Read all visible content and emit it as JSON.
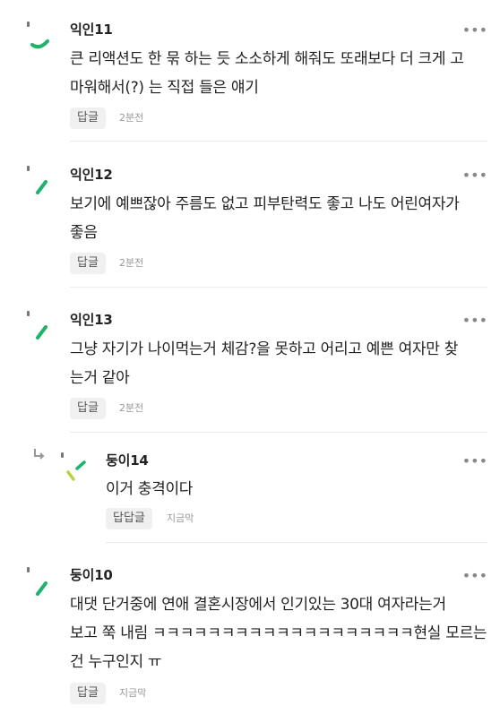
{
  "more_icon": "more-horizontal-icon",
  "comments": [
    {
      "author": "익인11",
      "lines": [
        "큰 리액션도 한 묶 하는 듯 소소하게 해줘도 또래보다 더 크게 고",
        "마워해서(?) 는 직접 들은 얘기"
      ],
      "reply_label": "답글",
      "time": "2분전"
    },
    {
      "author": "익인12",
      "lines": [
        "보기에 예쁘잖아 주름도 없고 피부탄력도 좋고 나도 어린여자가",
        "좋음"
      ],
      "reply_label": "답글",
      "time": "2분전"
    },
    {
      "author": "익인13",
      "lines": [
        "그냥 자기가 나이먹는거 체감?을 못하고 어리고 예쁜 여자만 찾",
        "는거 같아"
      ],
      "reply_label": "답글",
      "time": "2분전"
    },
    {
      "author": "둥이14",
      "lines": [
        "이거 충격이다"
      ],
      "reply_label": "답답글",
      "time": "지금막",
      "is_reply": true
    },
    {
      "author": "둥이10",
      "lines": [
        "대댓 단거중에 연애 결혼시장에서 인기있는 30대 여자라는거",
        "보고 쭉 내림 ㅋㅋㅋㅋㅋㅋㅋㅋㅋㅋㅋㅋㅋㅋㅋㅋㅋㅋㅋ현실 모르는",
        "건 누구인지 ㅠ"
      ],
      "reply_label": "답글",
      "time": "지금막"
    }
  ]
}
